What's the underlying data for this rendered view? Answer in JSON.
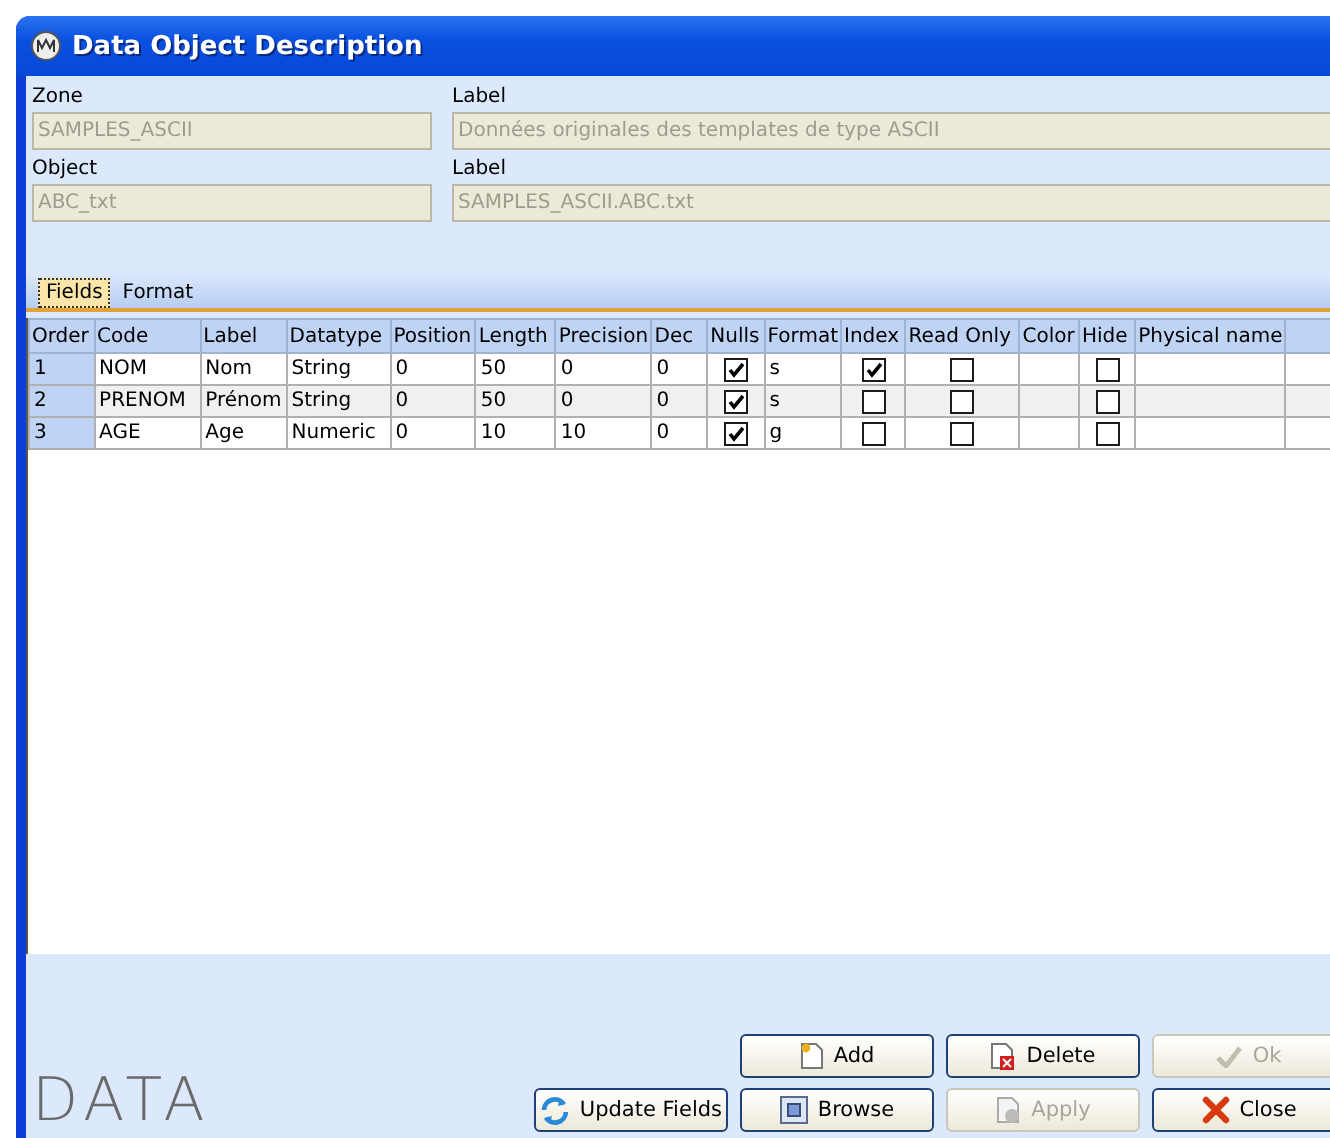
{
  "window": {
    "title": "Data Object Description"
  },
  "fields": [
    {
      "label": "Zone",
      "value": "SAMPLES_ASCII",
      "disabled": true
    },
    {
      "label": "Label",
      "value": "Données originales des templates de type ASCII",
      "disabled": true
    },
    {
      "label": "Object",
      "value": "ABC_txt",
      "disabled": true
    },
    {
      "label": "Label",
      "value": "SAMPLES_ASCII.ABC.txt",
      "disabled": true
    }
  ],
  "tabs": [
    {
      "label": "Fields",
      "selected": true
    },
    {
      "label": "Format",
      "selected": false
    }
  ],
  "table": {
    "columns": [
      {
        "label": "Order",
        "kind": "text"
      },
      {
        "label": "Code",
        "kind": "text"
      },
      {
        "label": "Label",
        "kind": "text"
      },
      {
        "label": "Datatype",
        "kind": "text"
      },
      {
        "label": "Position",
        "kind": "text"
      },
      {
        "label": "Length",
        "kind": "text"
      },
      {
        "label": "Precision",
        "kind": "text"
      },
      {
        "label": "Dec",
        "kind": "text"
      },
      {
        "label": "Nulls",
        "kind": "check"
      },
      {
        "label": "Format",
        "kind": "text"
      },
      {
        "label": "Index",
        "kind": "check"
      },
      {
        "label": "Read Only",
        "kind": "check"
      },
      {
        "label": "Color",
        "kind": "text"
      },
      {
        "label": "Hide",
        "kind": "check"
      },
      {
        "label": "Physical name",
        "kind": "text"
      }
    ],
    "rows": [
      {
        "cells": [
          "1",
          "NOM",
          "Nom",
          "String",
          "0",
          "50",
          "0",
          "0",
          true,
          "s",
          true,
          false,
          "",
          false,
          ""
        ]
      },
      {
        "cells": [
          "2",
          "PRENOM",
          "Prénom",
          "String",
          "0",
          "50",
          "0",
          "0",
          true,
          "s",
          false,
          false,
          "",
          false,
          ""
        ]
      },
      {
        "cells": [
          "3",
          "AGE",
          "Age",
          "Numeric",
          "0",
          "10",
          "10",
          "0",
          true,
          "g",
          false,
          false,
          "",
          false,
          ""
        ]
      }
    ]
  },
  "logo": "DATA",
  "buttons": [
    {
      "label": "Add",
      "disabled": false
    },
    {
      "label": "Delete",
      "disabled": false
    },
    {
      "label": "Ok",
      "disabled": true
    },
    {
      "label": "Update Fields",
      "disabled": false
    },
    {
      "label": "Browse",
      "disabled": false
    },
    {
      "label": "Apply",
      "disabled": true
    },
    {
      "label": "Close",
      "disabled": false
    }
  ]
}
